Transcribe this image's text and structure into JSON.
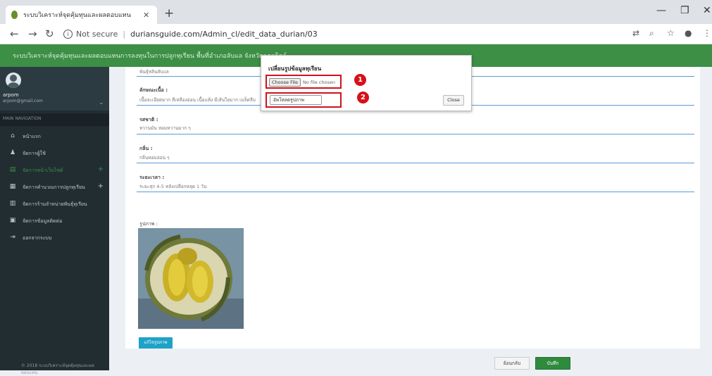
{
  "browser": {
    "tab_title": "ระบบวิเคราะห์จุดคุ้มทุนและผลตอบแทน",
    "url_secure_label": "Not secure",
    "url": "duriansguide.com/Admin_cl/edit_data_durian/03"
  },
  "app": {
    "header_title": "ระบบวิเคราะห์จุดคุ้มทุนและผลตอบแทนการลงทุนในการปลูกทุเรียน พื้นที่อำเภอลับแล จังหวัดอุตรดิตถ์",
    "accent_color": "#3c8f45"
  },
  "sidebar": {
    "user_name": "arpom",
    "user_email": "arpom@gmail.com",
    "nav_header": "MAIN NAVIGATION",
    "items": [
      {
        "label": "หน้าแรก",
        "icon": "home-icon",
        "has_plus": false,
        "active": false
      },
      {
        "label": "จัดการผู้ใช้",
        "icon": "user-icon",
        "has_plus": false,
        "active": false
      },
      {
        "label": "จัดการหน้าเว็บไซต์",
        "icon": "table-icon",
        "has_plus": true,
        "active": true
      },
      {
        "label": "จัดการคำนวณการปลูกทุเรียน",
        "icon": "calculator-icon",
        "has_plus": true,
        "active": false
      },
      {
        "label": "จัดการร้านจำหน่ายพันธุ์ทุเรียน",
        "icon": "store-icon",
        "has_plus": false,
        "active": false
      },
      {
        "label": "จัดการข้อมูลติดต่อ",
        "icon": "chat-icon",
        "has_plus": false,
        "active": false
      },
      {
        "label": "ออกจากระบบ",
        "icon": "logout-icon",
        "has_plus": false,
        "active": false
      }
    ],
    "footer": "© 2018 ระบบวิเคราะห์จุดคุ้มทุนและผลตอบแทน"
  },
  "form": {
    "fields": [
      {
        "label": "",
        "value": "พันธุ์หลินลับแล"
      },
      {
        "label": "ลักษณะเนื้อ :",
        "value": "เนื้อละเอียดมาก สีเหลืองอ่อน เนื้อแห้ง มีเส้นใยมาก เมล็ดลีบ"
      },
      {
        "label": "รสชาติ :",
        "value": "หวานมัน หอมหวานมาก ๆ"
      },
      {
        "label": "กลิ่น :",
        "value": "กลิ่นหอมอ่อน ๆ"
      },
      {
        "label": "ระยะเวลา :",
        "value": "ระยะสุก 4-5 หลังเปลือกหลุด 1 วัน"
      }
    ],
    "image_label": "รูปภาพ :",
    "change_image_button": "แก้ไขรูปภาพ",
    "back_button": "ย้อนกลับ",
    "save_button": "บันทึก"
  },
  "modal": {
    "title": "เปลี่ยนรูปข้อมูลทุเรียน",
    "choose_file_button": "Choose File",
    "no_file_text": "No file chosen",
    "upload_button": "อัพโหลดรูปภาพ",
    "close_button": "Close"
  },
  "annotations": {
    "badge1": "1",
    "badge2": "2",
    "highlight_color": "#d0121b"
  }
}
